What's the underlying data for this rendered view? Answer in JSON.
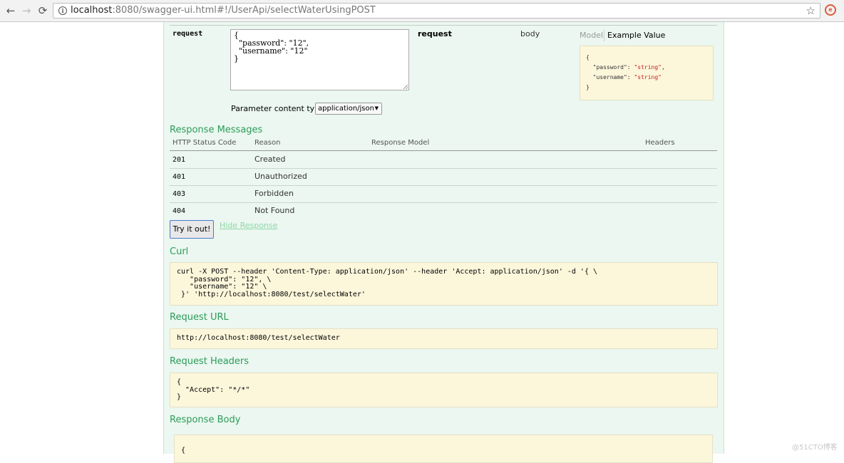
{
  "browser": {
    "url_host": "localhost",
    "url_path": ":8080/swagger-ui.html#!/UserApi/selectWaterUsingPOST",
    "back_glyph": "←",
    "forward_glyph": "→",
    "reload_glyph": "⟳",
    "star_glyph": "☆"
  },
  "parameter": {
    "name": "request",
    "value": "{\n  \"password\": \"12\",\n  \"username\": \"12\"\n}",
    "description": "request",
    "type": "body",
    "model_tab": "Model",
    "example_tab": "Example Value",
    "example_value": "{\n  \"password\": \"string\",\n  \"username\": \"string\"\n}",
    "content_type_label": "Parameter content type:",
    "content_type_value": "application/json"
  },
  "response_messages": {
    "title": "Response Messages",
    "headers": [
      "HTTP Status Code",
      "Reason",
      "Response Model",
      "Headers"
    ],
    "rows": [
      {
        "code": "201",
        "reason": "Created"
      },
      {
        "code": "401",
        "reason": "Unauthorized"
      },
      {
        "code": "403",
        "reason": "Forbidden"
      },
      {
        "code": "404",
        "reason": "Not Found"
      }
    ]
  },
  "actions": {
    "try_label": "Try it out!",
    "hide_label": "Hide Response"
  },
  "curl": {
    "title": "Curl",
    "text": "curl -X POST --header 'Content-Type: application/json' --header 'Accept: application/json' -d '{ \\\n   \"password\": \"12\", \\\n   \"username\": \"12\" \\\n }' 'http://localhost:8080/test/selectWater'"
  },
  "request_url": {
    "title": "Request URL",
    "text": "http://localhost:8080/test/selectWater"
  },
  "request_headers": {
    "title": "Request Headers",
    "text": "{\n  \"Accept\": \"*/*\"\n}"
  },
  "response_body": {
    "title": "Response Body",
    "text": "{"
  },
  "watermark": "@51CTO博客",
  "colors": {
    "section_heading": "#2c9c5a",
    "panel_bg": "#ebf7f0",
    "code_bg": "#fcf6db"
  }
}
